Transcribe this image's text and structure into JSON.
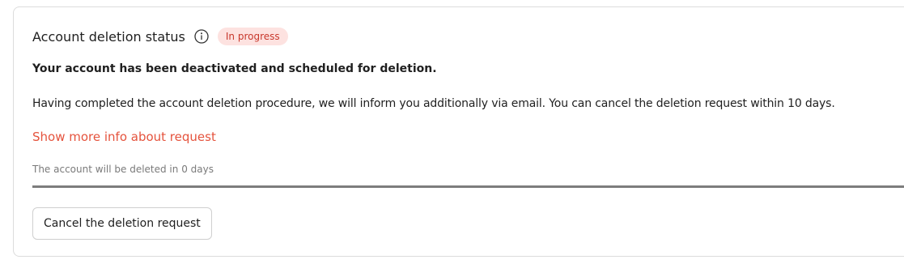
{
  "card": {
    "title": "Account deletion status",
    "info_icon": "info-circle-icon",
    "badge": "In progress",
    "headline": "Your account has been deactivated and scheduled for deletion.",
    "description": "Having completed the account deletion procedure, we will inform you additionally via email. You can cancel the deletion request within 10 days.",
    "more_info_link": "Show more info about request",
    "countdown_text": "The account will be deleted in 0 days",
    "progress_fraction": 1.0,
    "cancel_button": "Cancel the deletion request"
  },
  "colors": {
    "badge_bg": "#fde2e0",
    "badge_text": "#c8382c",
    "link": "#e5533d",
    "progress_fill": "#7d7d7d"
  }
}
